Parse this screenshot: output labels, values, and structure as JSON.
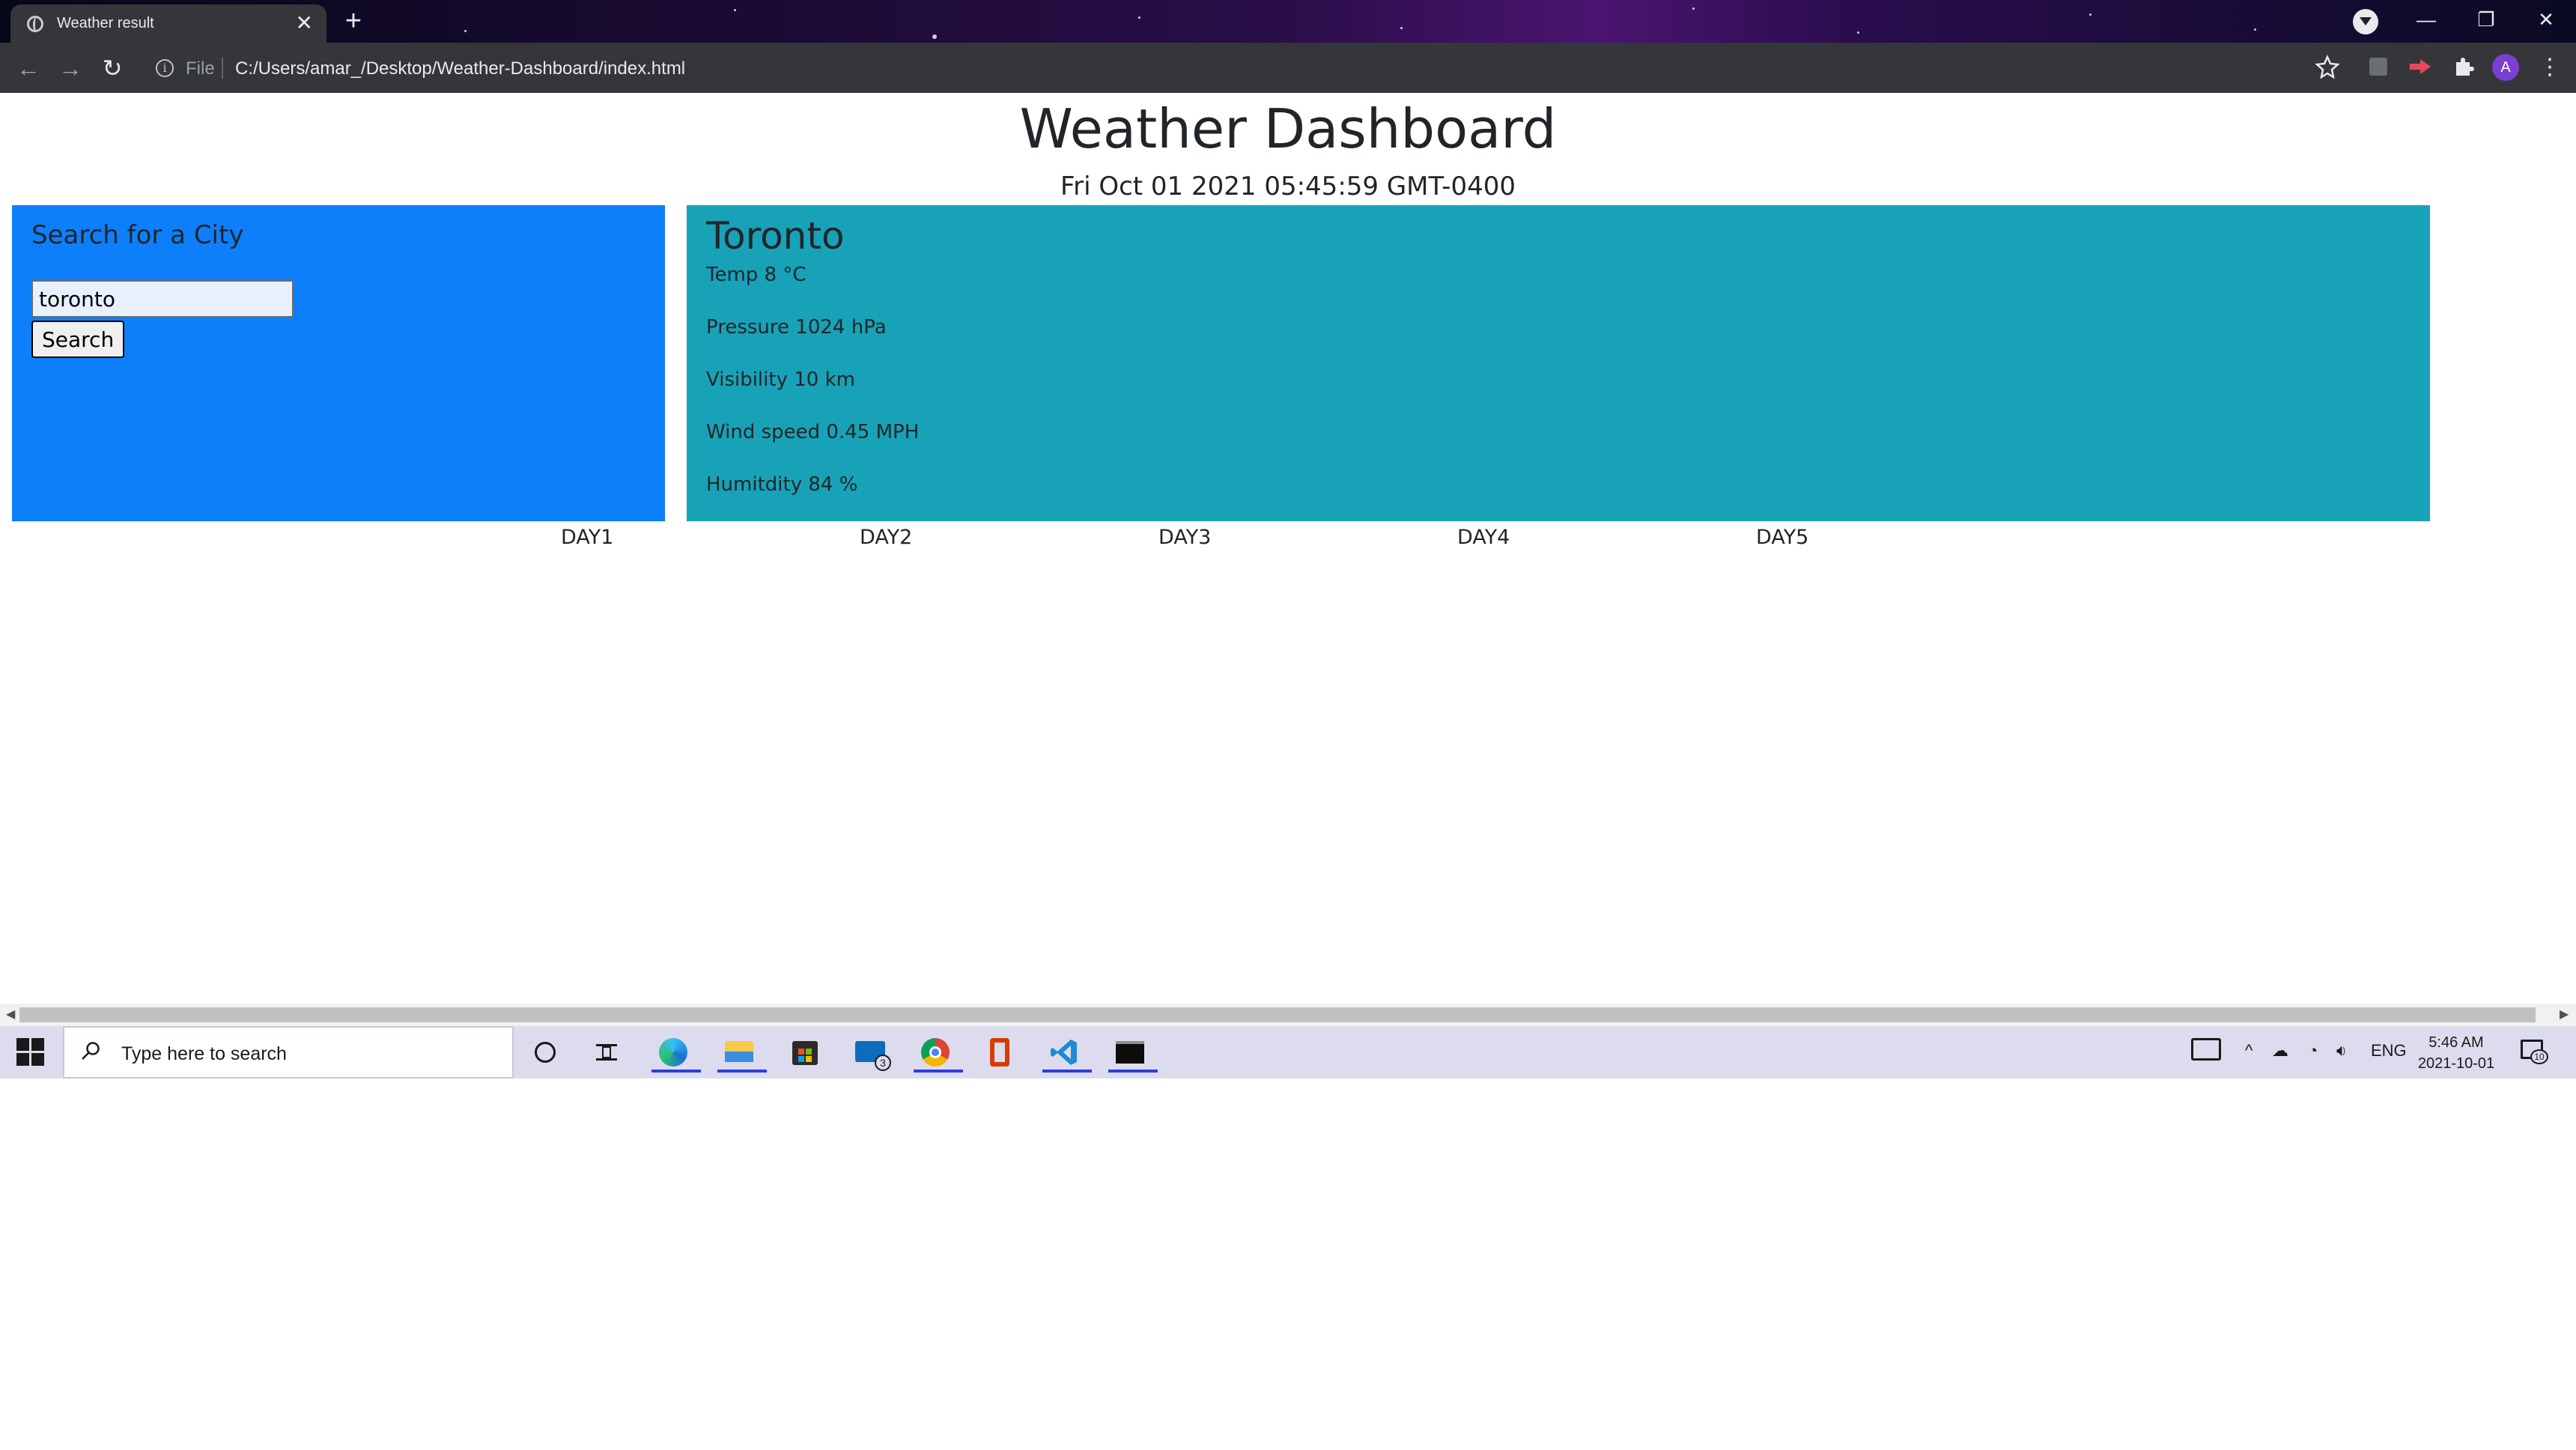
{
  "browser": {
    "tab_title": "Weather result",
    "tab_close": "✕",
    "new_tab": "+",
    "scheme": "File",
    "url": "C:/Users/amar_/Desktop/Weather-Dashboard/index.html",
    "profile_initial": "A",
    "window_controls": {
      "minimize": "—",
      "restore": "❐",
      "close": "✕"
    }
  },
  "page": {
    "title": "Weather Dashboard",
    "datetime": "Fri Oct 01 2021 05:45:59 GMT-0400"
  },
  "search": {
    "heading": "Search for a City",
    "input_value": "toronto",
    "button_label": "Search"
  },
  "current_weather": {
    "city": "Toronto",
    "temp": {
      "label": "Temp ",
      "value": "8",
      "unit": " °C"
    },
    "pressure": {
      "label": "Pressure ",
      "value": "1024",
      "unit": " hPa"
    },
    "visibility": {
      "label": "Visibility ",
      "value": "10",
      "unit": " km"
    },
    "wind": {
      "label": "Wind speed ",
      "value": "0.45",
      "unit": " MPH"
    },
    "humidity": {
      "label": "Humitdity ",
      "value": "84",
      "unit": " %"
    }
  },
  "forecast": {
    "days": [
      "DAY1",
      "DAY2",
      "DAY3",
      "DAY4",
      "DAY5"
    ]
  },
  "taskbar": {
    "search_placeholder": "Type here to search",
    "language": "ENG",
    "time": "5:46 AM",
    "date": "2021-10-01",
    "mail_badge": "3",
    "notifications_badge": "10",
    "icons": [
      "windows-start-icon",
      "cortana-icon",
      "task-view-icon",
      "edge-icon",
      "file-explorer-icon",
      "store-icon",
      "mail-icon",
      "chrome-icon",
      "office-icon",
      "vscode-icon",
      "terminal-icon"
    ]
  },
  "colors": {
    "search_panel": "#0d7ffb",
    "weather_panel": "#17a2b8",
    "browser_toolbar": "#35363a",
    "taskbar": "#dcdcee"
  }
}
